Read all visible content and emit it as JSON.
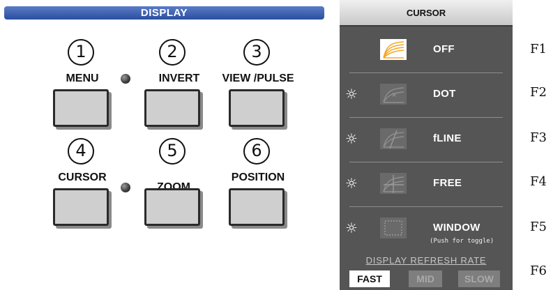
{
  "display": {
    "title": "DISPLAY",
    "keys": [
      {
        "number": "1",
        "label": "MENU",
        "led": false
      },
      {
        "number": "2",
        "label": "INVERT",
        "led": true
      },
      {
        "number": "3",
        "label": "VIEW /PULSE",
        "led": false
      },
      {
        "number": "4",
        "label": "CURSOR",
        "led": false
      },
      {
        "number": "5",
        "label": "ZOOM",
        "led": true
      },
      {
        "number": "6",
        "label": "POSITION",
        "led": false
      }
    ]
  },
  "cursor_panel": {
    "title": "CURSOR",
    "items": [
      {
        "label": "OFF",
        "icon": "cursor-off-icon",
        "selected": true,
        "sun": false
      },
      {
        "label": "DOT",
        "icon": "cursor-dot-icon",
        "selected": false,
        "sun": true
      },
      {
        "label": "fLINE",
        "icon": "cursor-fline-icon",
        "selected": false,
        "sun": true
      },
      {
        "label": "FREE",
        "icon": "cursor-free-icon",
        "selected": false,
        "sun": true
      },
      {
        "label": "WINDOW",
        "sub": "(Push for toggle)",
        "icon": "cursor-window-icon",
        "selected": false,
        "sun": true
      }
    ],
    "refresh": {
      "title": "DISPLAY REFRESH RATE",
      "options": [
        {
          "label": "FAST",
          "selected": true
        },
        {
          "label": "MID",
          "selected": false
        },
        {
          "label": "SLOW",
          "selected": false
        }
      ]
    }
  },
  "function_keys": [
    "F1",
    "F2",
    "F3",
    "F4",
    "F5",
    "F6"
  ],
  "colors": {
    "header_blue": "#2a4f9f",
    "panel_gray": "#555555",
    "off_icon_orange": "#f5a623"
  }
}
